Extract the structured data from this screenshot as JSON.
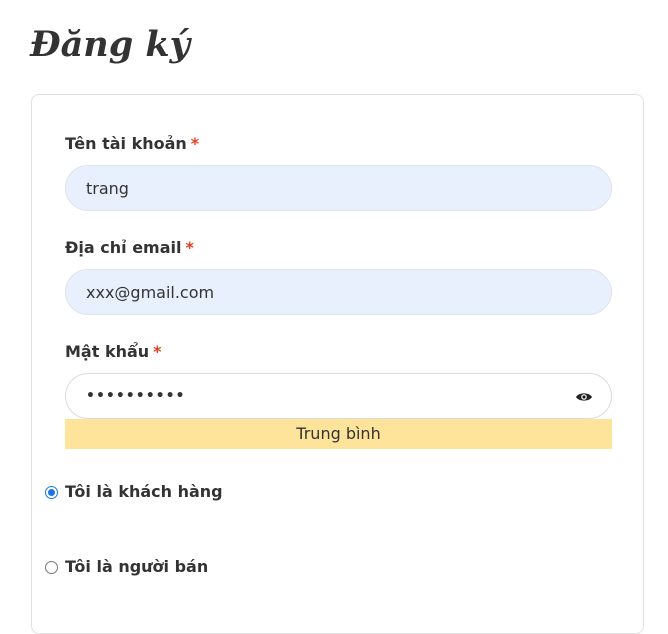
{
  "page": {
    "title": "Đăng ký"
  },
  "form": {
    "username": {
      "label": "Tên tài khoản",
      "required_mark": "*",
      "value": "trang"
    },
    "email": {
      "label": "Địa chỉ email",
      "required_mark": "*",
      "value": "xxx@gmail.com"
    },
    "password": {
      "label": "Mật khẩu",
      "required_mark": "*",
      "masked_value": "••••••••••",
      "strength": "Trung bình"
    },
    "role_options": [
      {
        "label": "Tôi là khách hàng",
        "selected": true
      },
      {
        "label": "Tôi là người bán",
        "selected": false
      }
    ]
  },
  "colors": {
    "required": "#e2401c",
    "autofill_bg": "#e8f0fe",
    "strength_bg": "#fee39a",
    "radio_accent": "#1a73e8"
  },
  "icons": {
    "password_toggle": "eye-icon"
  }
}
